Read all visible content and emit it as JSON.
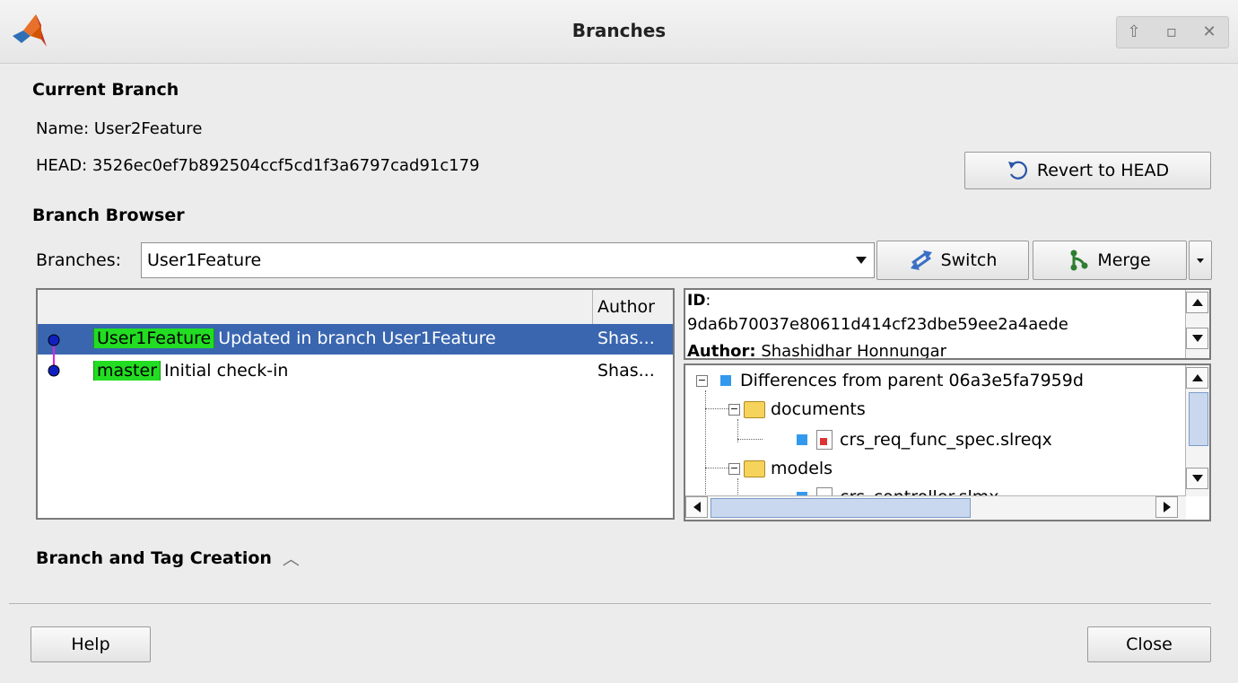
{
  "window": {
    "title": "Branches",
    "controls": [
      "up-icon",
      "maximize-icon",
      "close-icon"
    ]
  },
  "current_branch": {
    "heading": "Current Branch",
    "name_line": "Name: User2Feature",
    "head_line": "HEAD: 3526ec0ef7b892504ccf5cd1f3a6797cad91c179",
    "revert_label": "Revert to HEAD"
  },
  "branch_browser": {
    "heading": "Branch Browser",
    "branches_label": "Branches:",
    "selected_branch": "User1Feature",
    "switch_label": "Switch",
    "merge_label": "Merge",
    "list_header_author": "Author",
    "commits": [
      {
        "tag": "User1Feature",
        "message": "Updated in branch User1Feature",
        "author": "Shas...",
        "selected": true
      },
      {
        "tag": "master",
        "message": "Initial check-in",
        "author": "Shas...",
        "selected": false
      }
    ],
    "details": {
      "id_label": "ID",
      "id_colon": ":",
      "id_value": "9da6b70037e80611d414cf23dbe59ee2a4aede",
      "author_label": "Author:",
      "author_value": "Shashidhar Honnungar"
    },
    "tree": {
      "root": "Differences from parent 06a3e5fa7959d",
      "folders": [
        {
          "name": "documents",
          "files": [
            "crs_req_func_spec.slreqx"
          ]
        },
        {
          "name": "models",
          "files": [
            "crs_controller.slmx"
          ]
        }
      ]
    }
  },
  "branch_tag_creation": {
    "label": "Branch and Tag Creation"
  },
  "footer": {
    "help_label": "Help",
    "close_label": "Close"
  },
  "colors": {
    "tag_green": "#22dd22",
    "selection_blue": "#3a66b0",
    "file_marker": "#3399ee"
  }
}
